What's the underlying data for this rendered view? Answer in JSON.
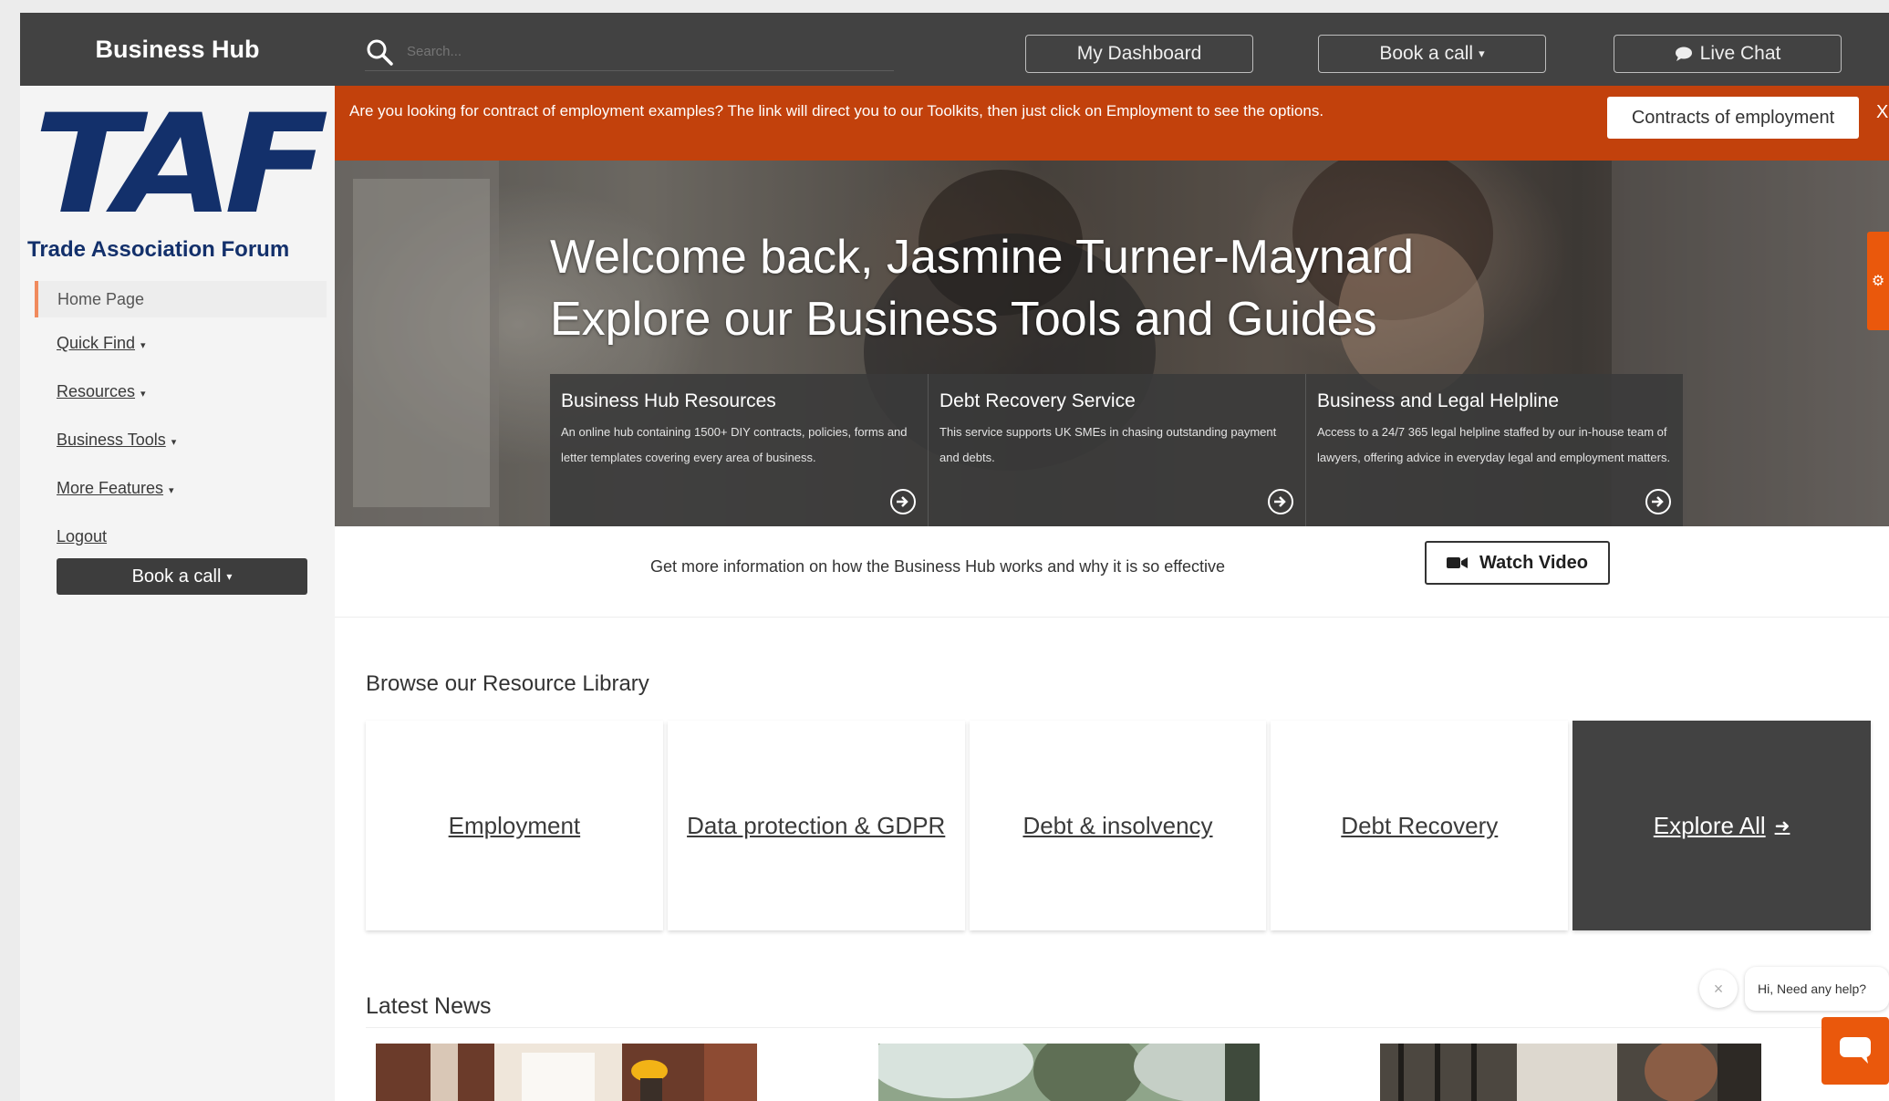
{
  "header": {
    "brand": "Business Hub",
    "search_placeholder": "Search...",
    "dashboard_label": "My Dashboard",
    "book_call_label": "Book a call",
    "live_chat_label": "Live Chat"
  },
  "sidebar": {
    "logo_text": "TAF",
    "logo_subtitle": "Trade Association Forum",
    "items": [
      {
        "label": "Home Page",
        "active": true,
        "has_caret": false
      },
      {
        "label": "Quick Find",
        "active": false,
        "has_caret": true
      },
      {
        "label": "Resources",
        "active": false,
        "has_caret": true
      },
      {
        "label": "Business Tools",
        "active": false,
        "has_caret": true
      },
      {
        "label": "More Features",
        "active": false,
        "has_caret": true
      },
      {
        "label": "Logout",
        "active": false,
        "has_caret": false
      }
    ],
    "book_call_label": "Book a call"
  },
  "notice": {
    "text": "Are you looking for contract of employment examples? The link will direct you to our Toolkits, then just click on Employment to see the options.",
    "button_label": "Contracts of employment",
    "close_label": "X"
  },
  "hero": {
    "title_line1": "Welcome back, Jasmine Turner-Maynard",
    "title_line2": "Explore our Business Tools and Guides",
    "cards": [
      {
        "title": "Business Hub Resources",
        "description": "An online hub containing 1500+ DIY contracts, policies, forms and letter templates covering every area of business."
      },
      {
        "title": "Debt Recovery Service",
        "description": "This service supports UK SMEs in chasing outstanding payment and debts."
      },
      {
        "title": "Business and Legal Helpline",
        "description": "Access to a 24/7 365 legal helpline staffed by our in-house team of lawyers, offering advice in everyday legal and employment matters."
      }
    ]
  },
  "video": {
    "text": "Get more information on how the Business Hub works and why it is so effective",
    "button_label": "Watch Video"
  },
  "library": {
    "title": "Browse our Resource Library",
    "tiles": [
      "Employment",
      "Data protection & GDPR",
      "Debt & insolvency",
      "Debt Recovery"
    ],
    "explore_label": "Explore All"
  },
  "news": {
    "title": "Latest News"
  },
  "chat": {
    "bubble_text": "Hi, Need any help?",
    "close_label": "×"
  },
  "colors": {
    "topbar": "#424242",
    "accent": "#c2410c",
    "chat_accent": "#ea580c",
    "logo": "#13306b"
  }
}
